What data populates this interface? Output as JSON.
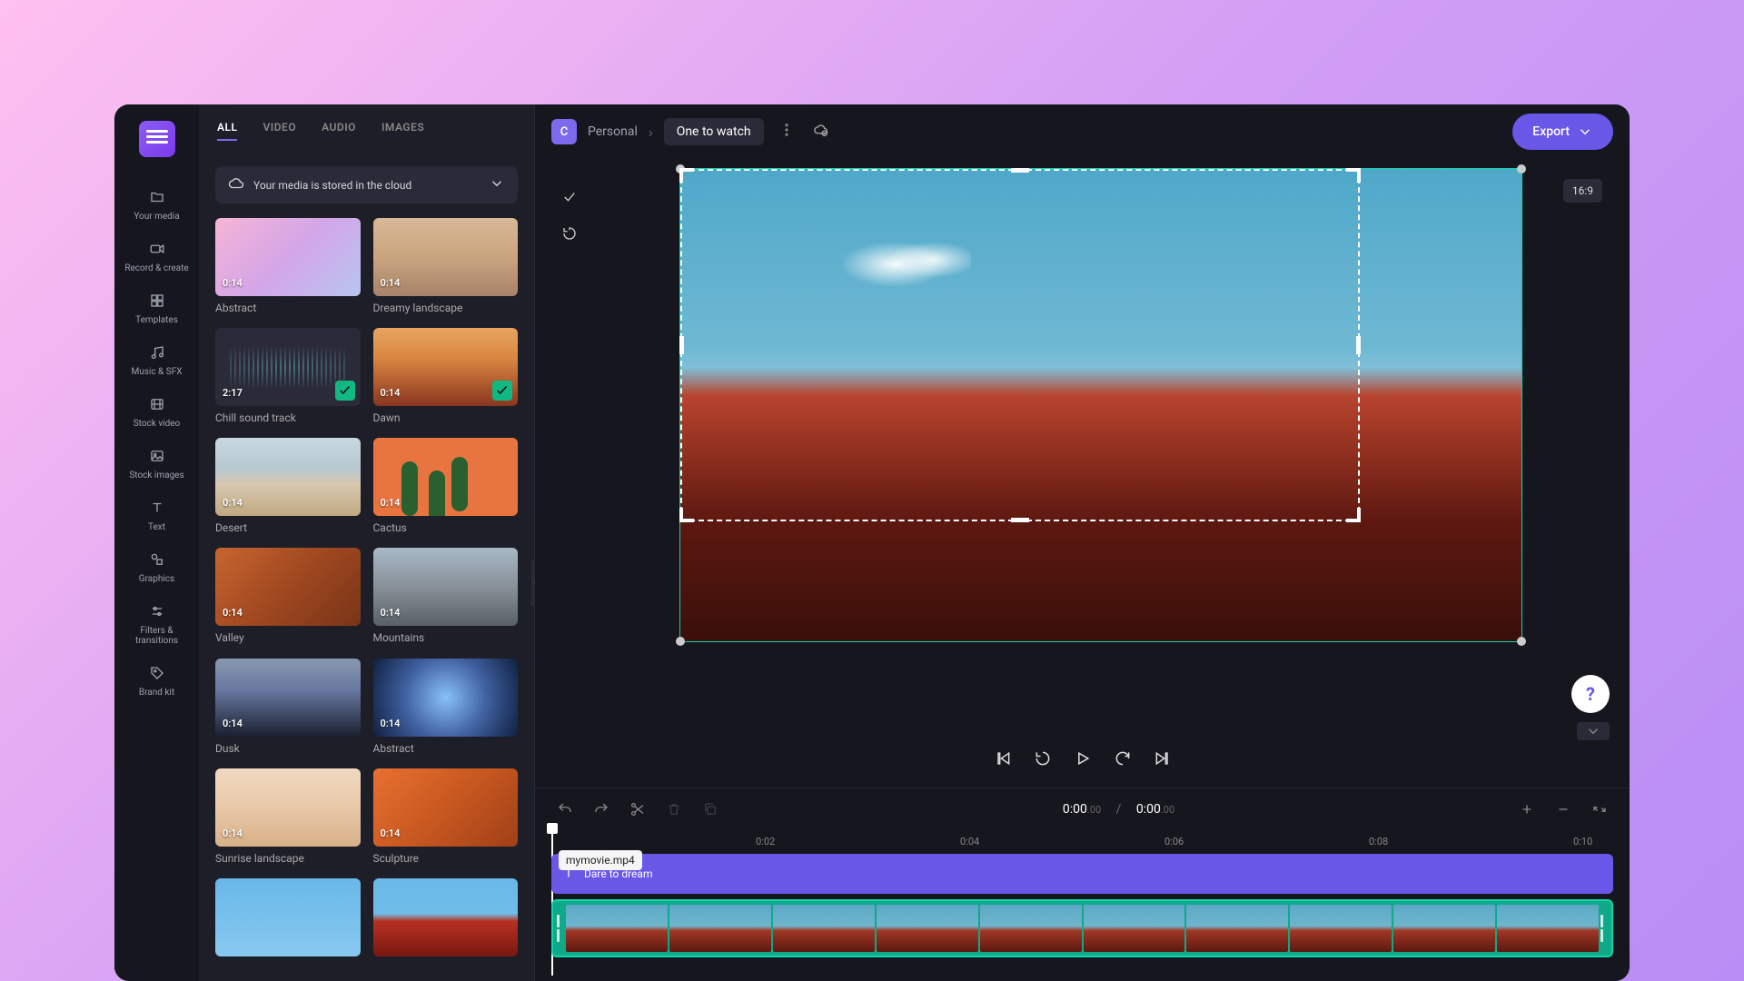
{
  "rail": {
    "items": [
      {
        "label": "Your media",
        "icon": "folder"
      },
      {
        "label": "Record & create",
        "icon": "video"
      },
      {
        "label": "Templates",
        "icon": "grid"
      },
      {
        "label": "Music & SFX",
        "icon": "music"
      },
      {
        "label": "Stock video",
        "icon": "film"
      },
      {
        "label": "Stock images",
        "icon": "image"
      },
      {
        "label": "Text",
        "icon": "text"
      },
      {
        "label": "Graphics",
        "icon": "shapes"
      },
      {
        "label": "Filters & transitions",
        "icon": "sliders"
      },
      {
        "label": "Brand kit",
        "icon": "tag"
      }
    ]
  },
  "tabs": {
    "items": [
      "ALL",
      "VIDEO",
      "AUDIO",
      "IMAGES"
    ],
    "active": 0
  },
  "storage": {
    "text": "Your media is stored in the cloud"
  },
  "media": [
    {
      "name": "Abstract",
      "dur": "0:14",
      "art": "t-abstract"
    },
    {
      "name": "Dreamy landscape",
      "dur": "0:14",
      "art": "t-dreamy"
    },
    {
      "name": "Chill sound track",
      "dur": "2:17",
      "art": "t-sound",
      "used": true
    },
    {
      "name": "Dawn",
      "dur": "0:14",
      "art": "t-dawn",
      "used": true
    },
    {
      "name": "Desert",
      "dur": "0:14",
      "art": "t-desert"
    },
    {
      "name": "Cactus",
      "dur": "0:14",
      "art": "t-cactus"
    },
    {
      "name": "Valley",
      "dur": "0:14",
      "art": "t-valley"
    },
    {
      "name": "Mountains",
      "dur": "0:14",
      "art": "t-mountains"
    },
    {
      "name": "Dusk",
      "dur": "0:14",
      "art": "t-dusk"
    },
    {
      "name": "Abstract",
      "dur": "0:14",
      "art": "t-abstract2"
    },
    {
      "name": "Sunrise landscape",
      "dur": "0:14",
      "art": "t-sunrise"
    },
    {
      "name": "Sculpture",
      "dur": "0:14",
      "art": "t-sculpture"
    },
    {
      "name": "",
      "dur": "",
      "art": "t-sky"
    },
    {
      "name": "",
      "dur": "",
      "art": "t-red"
    }
  ],
  "breadcrumb": {
    "badge": "C",
    "workspace": "Personal",
    "project": "One to watch"
  },
  "export_label": "Export",
  "ratio": "16:9",
  "timecode": {
    "current": "0:00",
    "current_sub": ".00",
    "total": "0:00",
    "total_sub": ".00",
    "sep": "/"
  },
  "ruler": [
    "0:02",
    "0:04",
    "0:06",
    "0:08",
    "0:10"
  ],
  "tracks": {
    "text_label": "Dare to dream",
    "tooltip": "mymovie.mp4"
  },
  "help": "?"
}
